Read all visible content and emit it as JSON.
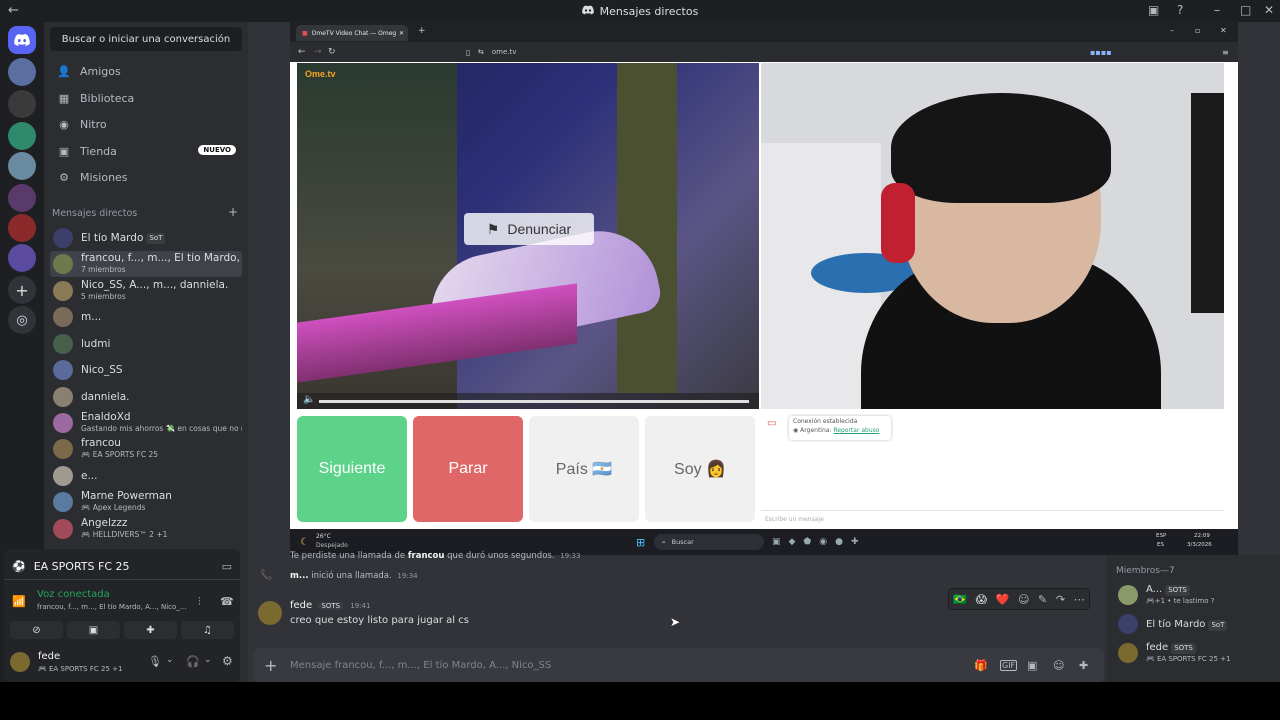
{
  "window": {
    "title": "Mensajes directos"
  },
  "sidebar": {
    "search_label": "Buscar o iniciar una conversación",
    "nav": [
      {
        "label": "Amigos",
        "icon": "friends-icon"
      },
      {
        "label": "Biblioteca",
        "icon": "library-icon"
      },
      {
        "label": "Nitro",
        "icon": "nitro-icon"
      },
      {
        "label": "Tienda",
        "icon": "shop-icon",
        "badge": "NUEVO"
      },
      {
        "label": "Misiones",
        "icon": "quests-icon"
      }
    ],
    "dm_header": "Mensajes directos",
    "dm_add": "+",
    "dms": [
      {
        "name": "El tío Mardo",
        "sub": "",
        "tag": "SoT",
        "color": "#3b3f69"
      },
      {
        "name": "francou, f..., m..., El tío Mardo, A...",
        "sub": "7 miembros",
        "color": "#6c7a4e"
      },
      {
        "name": "Nico_SS, A..., m..., danniela.",
        "sub": "5 miembros",
        "color": "#8a7a55"
      },
      {
        "name": "m...",
        "sub": "",
        "color": "#7a6a5a"
      },
      {
        "name": "ludmi",
        "sub": "",
        "color": "#46604a"
      },
      {
        "name": "Nico_SS",
        "sub": "",
        "color": "#5a6a9a"
      },
      {
        "name": "danniela.",
        "sub": "",
        "color": "#8a8070"
      },
      {
        "name": "EnaldoXd",
        "sub": "Gastando mis ahorros 💸 en cosas que no nec",
        "color": "#9a6aa0"
      },
      {
        "name": "francou",
        "sub": "🎮 EA SPORTS FC 25",
        "color": "#7a6a4a"
      },
      {
        "name": "e...",
        "sub": "",
        "color": "#a09a90"
      },
      {
        "name": "Marne Powerman",
        "sub": "🎮 Apex Legends",
        "color": "#5a7aa0"
      },
      {
        "name": "Angelzzz",
        "sub": "🎮 HELLDIVERS™ 2 +1",
        "color": "#a04a5a"
      }
    ]
  },
  "voice": {
    "game": "EA SPORTS FC 25",
    "status": "Voz conectada",
    "channel": "francou, f..., m..., El tío Mardo, A..., Nico_...",
    "user": "fede",
    "user_activity": "🎮 EA SPORTS FC 25 +1"
  },
  "stream": {
    "browser_tab": "OmeTV Video Chat — Omeg",
    "url": "ome.tv",
    "brand": "Ome.tv",
    "report_button": "Denunciar",
    "buttons": [
      "Siguiente",
      "Parar",
      "País 🇦🇷",
      "Soy 👩"
    ],
    "connection_text": "Conexión establecida",
    "country_text": "Argentina:",
    "report_abuse": "Reportar abuso",
    "chat_placeholder": "Escribe un mensaje",
    "weather_temp": "26°C",
    "weather_desc": "Despejado",
    "taskbar_search": "Buscar",
    "lang": "ESP",
    "region": "ES",
    "time": "22:09",
    "date": "3/3/2026"
  },
  "messages": {
    "sys1": "Te perdiste una llamada de",
    "sys1_user": "francou",
    "sys1_tail": "que duró unos segundos.",
    "sys1_time": "19:33",
    "sys2_user": "m...",
    "sys2_text": "inició una llamada.",
    "sys2_time": "19:34",
    "author": "fede",
    "author_tag": "SOTS",
    "time": "19:41",
    "text": "creo que estoy listo para jugar al cs",
    "composer_placeholder": "Mensaje francou, f..., m..., El tío Mardo, A..., Nico_SS"
  },
  "members": {
    "header": "Miembros—7",
    "list": [
      {
        "name": "A...",
        "tag": "SOTS",
        "sub": "🎮+1 • te lastimo ?",
        "color": "#8a9a6a"
      },
      {
        "name": "El tío Mardo",
        "tag": "SoT",
        "sub": "",
        "color": "#3b3f69"
      },
      {
        "name": "fede",
        "tag": "SOTS",
        "sub": "🎮 EA SPORTS FC 25 +1",
        "color": "#7a6a30"
      }
    ]
  }
}
